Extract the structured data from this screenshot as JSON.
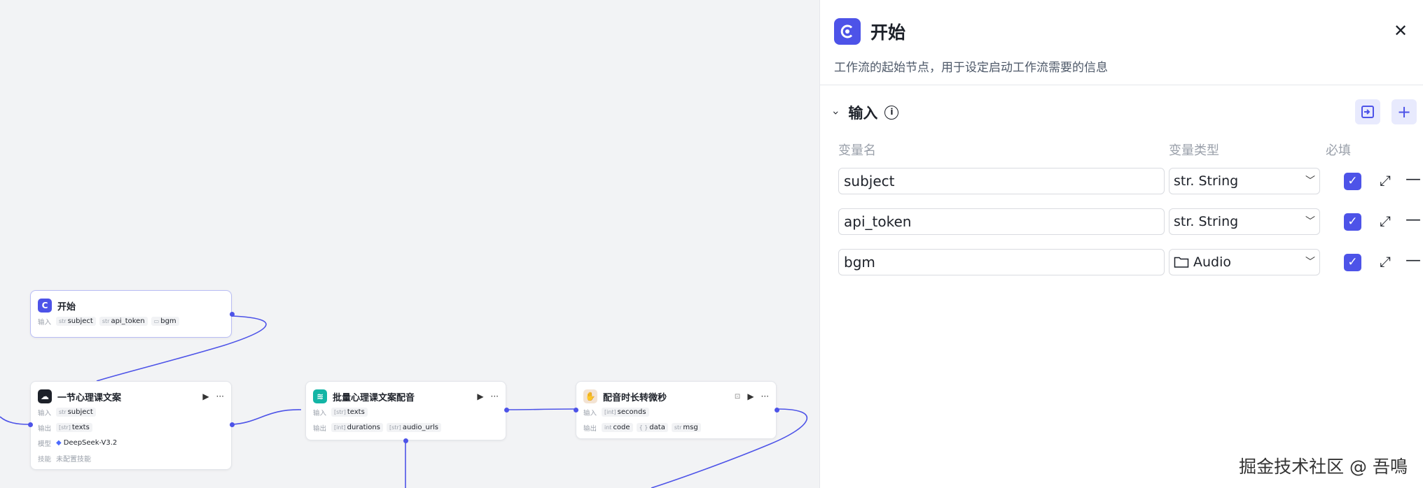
{
  "canvas": {
    "nodes": {
      "start": {
        "title": "开始",
        "rows": [
          {
            "label": "输入",
            "tags": [
              {
                "type": "str",
                "name": "subject"
              },
              {
                "type": "str",
                "name": "api_token"
              },
              {
                "type": "folder",
                "name": "bgm"
              }
            ]
          }
        ]
      },
      "llm": {
        "title": "一节心理课文案",
        "rows": [
          {
            "label": "输入",
            "tags": [
              {
                "type": "str",
                "name": "subject"
              }
            ]
          },
          {
            "label": "输出",
            "tags": [
              {
                "type": "[str]",
                "name": "texts"
              }
            ]
          },
          {
            "label": "模型",
            "model": "DeepSeek-V3.2"
          },
          {
            "label": "技能",
            "note": "未配置技能"
          }
        ]
      },
      "tts": {
        "title": "批量心理课文案配音",
        "rows": [
          {
            "label": "输入",
            "tags": [
              {
                "type": "[str]",
                "name": "texts"
              }
            ]
          },
          {
            "label": "输出",
            "tags": [
              {
                "type": "[int]",
                "name": "durations"
              },
              {
                "type": "[str]",
                "name": "audio_urls"
              }
            ]
          }
        ]
      },
      "convert": {
        "title": "配音时长转微秒",
        "rows": [
          {
            "label": "输入",
            "tags": [
              {
                "type": "[int]",
                "name": "seconds"
              }
            ]
          },
          {
            "label": "输出",
            "tags": [
              {
                "type": "int",
                "name": "code"
              },
              {
                "type": "{ }",
                "name": "data"
              },
              {
                "type": "str",
                "name": "msg"
              }
            ]
          }
        ]
      }
    }
  },
  "panel": {
    "title": "开始",
    "description": "工作流的起始节点，用于设定启动工作流需要的信息",
    "section_title": "输入",
    "columns": {
      "name": "变量名",
      "type": "变量类型",
      "required": "必填"
    },
    "variables": [
      {
        "name": "subject",
        "type": "str. String",
        "required": true
      },
      {
        "name": "api_token",
        "type": "str. String",
        "required": true
      },
      {
        "name": "bgm",
        "type": "Audio",
        "required": true
      }
    ]
  },
  "watermark": "掘金技术社区 @ 吾鳴",
  "colors": {
    "accent": "#4d53e8",
    "edge": "#4d53e8",
    "tts": "#13b5a5",
    "canvas": "#f2f3f5"
  }
}
